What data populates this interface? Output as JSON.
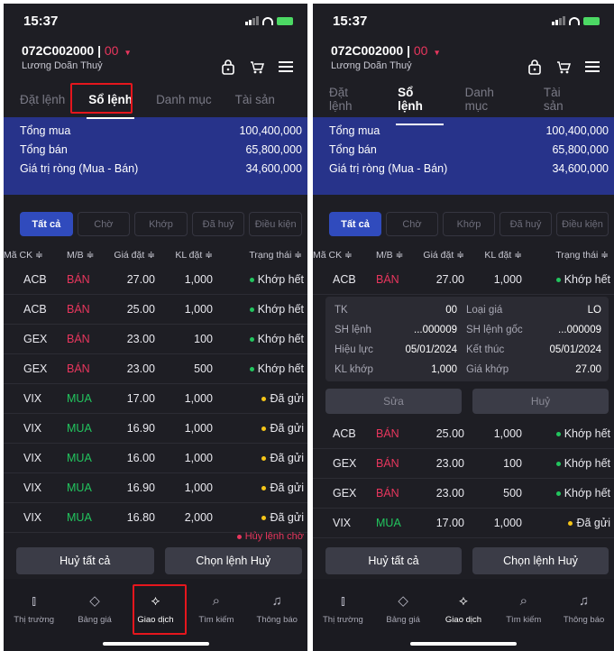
{
  "status": {
    "time": "15:37"
  },
  "account": {
    "id": "072C002000",
    "sep": "|",
    "sub": "00",
    "name": "Lương Doãn Thuỷ"
  },
  "tabs": [
    "Đặt lệnh",
    "Sổ lệnh",
    "Danh mục",
    "Tài sản"
  ],
  "summary": [
    {
      "label": "Tổng mua",
      "value": "100,400,000"
    },
    {
      "label": "Tổng bán",
      "value": "65,800,000"
    },
    {
      "label": "Giá trị ròng (Mua - Bán)",
      "value": "34,600,000"
    }
  ],
  "filters": [
    "Tất cả",
    "Chờ",
    "Khớp",
    "Đã huỷ",
    "Điều kiện"
  ],
  "columns": [
    "Mã CK ≑",
    "M/B ≑",
    "Giá đặt ≑",
    "KL đặt ≑",
    "Trạng thái ≑"
  ],
  "orders": [
    {
      "sym": "ACB",
      "side": "BÁN",
      "price": "27.00",
      "qty": "1,000",
      "status": "Khớp hết",
      "color": "green"
    },
    {
      "sym": "ACB",
      "side": "BÁN",
      "price": "25.00",
      "qty": "1,000",
      "status": "Khớp hết",
      "color": "green"
    },
    {
      "sym": "GEX",
      "side": "BÁN",
      "price": "23.00",
      "qty": "100",
      "status": "Khớp hết",
      "color": "green"
    },
    {
      "sym": "GEX",
      "side": "BÁN",
      "price": "23.00",
      "qty": "500",
      "status": "Khớp hết",
      "color": "green"
    },
    {
      "sym": "VIX",
      "side": "MUA",
      "price": "17.00",
      "qty": "1,000",
      "status": "Đã gửi",
      "color": "yellow"
    },
    {
      "sym": "VIX",
      "side": "MUA",
      "price": "16.90",
      "qty": "1,000",
      "status": "Đã gửi",
      "color": "yellow"
    },
    {
      "sym": "VIX",
      "side": "MUA",
      "price": "16.00",
      "qty": "1,000",
      "status": "Đã gửi",
      "color": "yellow"
    },
    {
      "sym": "VIX",
      "side": "MUA",
      "price": "16.90",
      "qty": "1,000",
      "status": "Đã gửi",
      "color": "yellow"
    },
    {
      "sym": "VIX",
      "side": "MUA",
      "price": "16.80",
      "qty": "2,000",
      "status": "Đã gửi",
      "color": "yellow"
    }
  ],
  "pending_status": "Hủy lệnh chờ",
  "actions": {
    "cancel_all": "Huỷ tất cả",
    "select_cancel": "Chọn lệnh Huỷ"
  },
  "nav": [
    "Thị trường",
    "Bảng giá",
    "Giao dịch",
    "Tìm kiếm",
    "Thông báo"
  ],
  "detail": {
    "rows": [
      {
        "l1": "TK",
        "v1": "00",
        "l2": "Loại giá",
        "v2": "LO"
      },
      {
        "l1": "SH lệnh",
        "v1": "...000009",
        "l2": "SH lệnh gốc",
        "v2": "...000009"
      },
      {
        "l1": "Hiệu lực",
        "v1": "05/01/2024",
        "l2": "Kết thúc",
        "v2": "05/01/2024"
      },
      {
        "l1": "KL khớp",
        "v1": "1,000",
        "l2": "Giá khớp",
        "v2": "27.00"
      }
    ],
    "edit": "Sửa",
    "cancel": "Huỷ"
  },
  "colors": {
    "buy": "#22c55e",
    "sell": "#e8365d",
    "accent": "#304bbd",
    "summary_bg": "#27338a",
    "highlight": "#e5161d"
  }
}
